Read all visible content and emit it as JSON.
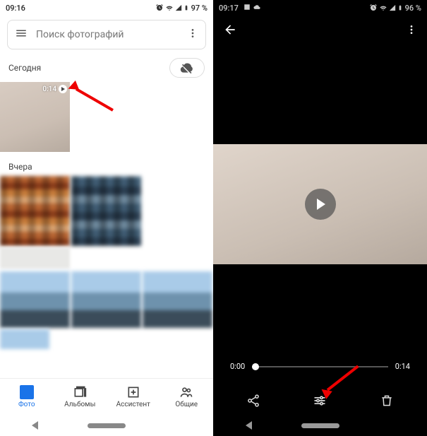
{
  "left": {
    "status": {
      "time": "09:16",
      "battery": "97 %"
    },
    "search": {
      "placeholder": "Поиск фотографий"
    },
    "sections": {
      "today": "Сегодня",
      "yesterday": "Вчера"
    },
    "video": {
      "duration": "0:14"
    },
    "nav": {
      "photos": "Фото",
      "albums": "Альбомы",
      "assistant": "Ассистент",
      "shared": "Общие"
    }
  },
  "right": {
    "status": {
      "time": "09:17",
      "battery": "96 %"
    },
    "scrubber": {
      "start": "0:00",
      "end": "0:14"
    }
  }
}
